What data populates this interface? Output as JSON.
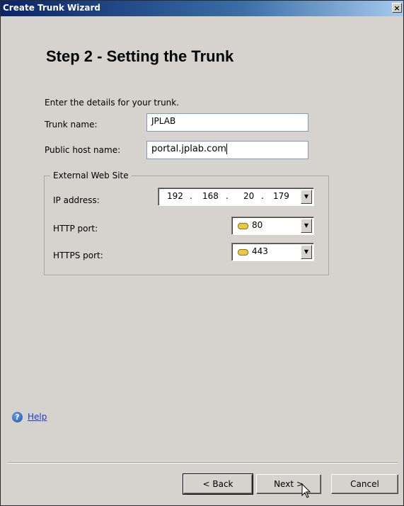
{
  "window": {
    "title": "Create Trunk Wizard",
    "close_glyph": "×"
  },
  "heading": "Step 2 - Setting the Trunk",
  "intro": "Enter the details for your trunk.",
  "fields": {
    "trunk_name": {
      "label": "Trunk name:",
      "value": "JPLAB"
    },
    "public_host": {
      "label": "Public host name:",
      "value": "portal.jplab.com"
    }
  },
  "external": {
    "title": "External Web Site",
    "ip": {
      "label": "IP address:",
      "parts": [
        "192",
        "168",
        "20",
        "179"
      ],
      "separator": "."
    },
    "http": {
      "label": "HTTP port:",
      "value": "80"
    },
    "https": {
      "label": "HTTPS port:",
      "value": "443"
    }
  },
  "help": {
    "icon": "help-icon",
    "label": "Help"
  },
  "buttons": {
    "back": "< Back",
    "next": "Next >",
    "cancel": "Cancel"
  }
}
